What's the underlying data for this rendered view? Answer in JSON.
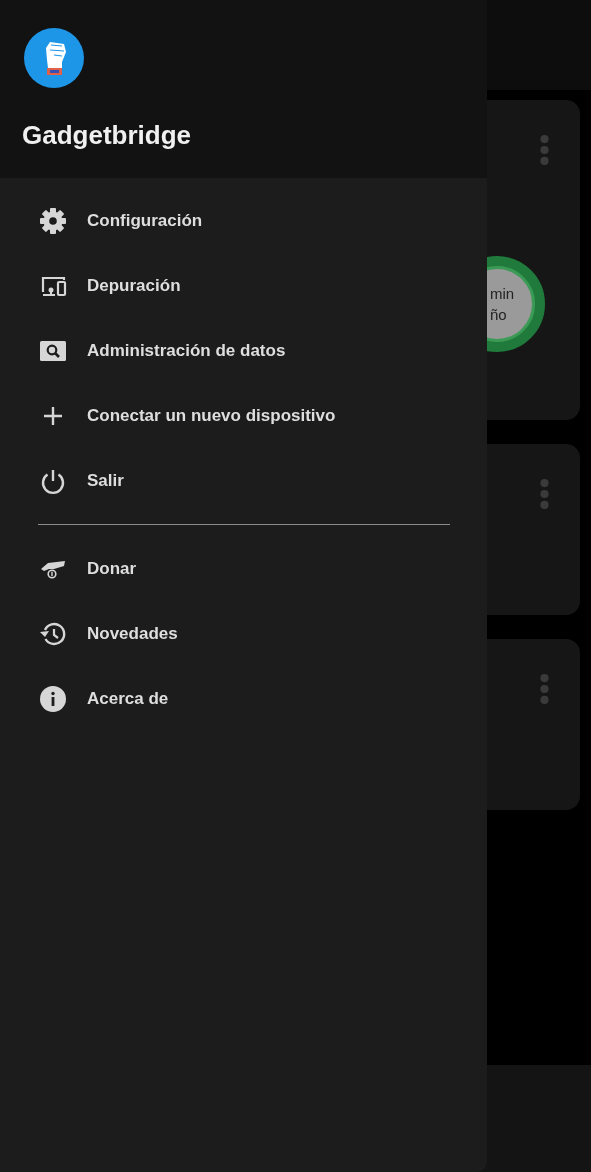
{
  "header": {
    "title": "Gadgetbridge"
  },
  "menu_sections": [
    [
      {
        "label": "Configuración"
      },
      {
        "label": "Depuración"
      },
      {
        "label": "Administración de datos"
      },
      {
        "label": "Conectar un nuevo dispositivo"
      },
      {
        "label": "Salir"
      }
    ],
    [
      {
        "label": "Donar"
      },
      {
        "label": "Novedades"
      },
      {
        "label": "Acerca de"
      }
    ]
  ],
  "background": {
    "cards": [
      {
        "kind": "activity",
        "ring_texts": [
          "min",
          "ño"
        ]
      },
      {
        "kind": "plain"
      },
      {
        "kind": "plain"
      }
    ]
  }
}
